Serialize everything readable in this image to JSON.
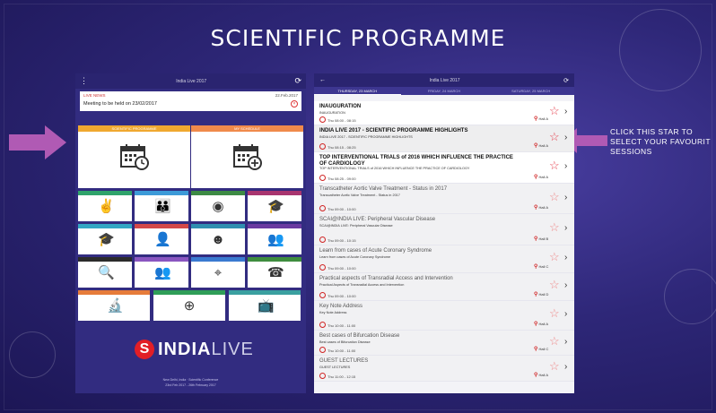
{
  "slide": {
    "title": "SCIENTIFIC PROGRAMME",
    "callout": "CLICK THIS STAR TO SELECT YOUR FAVOURIT SESSIONS"
  },
  "left_app": {
    "header_title": "India Live 2017",
    "menu_icon": "menu-icon",
    "refresh_icon": "refresh-icon",
    "notice": {
      "title": "LIVE NEWS",
      "date": "22.Feb.2017",
      "message": "Meeting to be held on 23/02/2017"
    },
    "big_tiles": [
      {
        "label": "SCIENTIFIC PROGRAMME",
        "color": "#f0a830",
        "icon": "calendar-clock-icon"
      },
      {
        "label": "MY SCHEDULE",
        "color": "#f08a4b",
        "icon": "calendar-add-icon"
      }
    ],
    "tiles": [
      {
        "color": "#2fa36b",
        "icon": "handshake-icon",
        "glyph": "✌"
      },
      {
        "color": "#3c9ad8",
        "icon": "group-icon",
        "glyph": "👪"
      },
      {
        "color": "#3d8a44",
        "icon": "book-icon",
        "glyph": "◉"
      },
      {
        "color": "#a8356f",
        "icon": "presenter-icon",
        "glyph": "🎓"
      },
      {
        "color": "#33a7c4",
        "icon": "board-presenter-icon",
        "glyph": "🎓"
      },
      {
        "color": "#d44848",
        "icon": "speaker-icon",
        "glyph": "👤"
      },
      {
        "color": "#2f8fb0",
        "icon": "chat-person-icon",
        "glyph": "☻"
      },
      {
        "color": "#6a3aa0",
        "icon": "meeting-icon",
        "glyph": "👥"
      },
      {
        "color": "#2b2b2b",
        "icon": "search-icon",
        "glyph": "🔍"
      },
      {
        "color": "#8a56c0",
        "icon": "users-icon",
        "glyph": "👥"
      },
      {
        "color": "#3a7ad0",
        "icon": "location-pin-icon",
        "glyph": "⌖"
      },
      {
        "color": "#3f8d3f",
        "icon": "phone-icon",
        "glyph": "☎"
      },
      {
        "color": "#e67c3a",
        "icon": "microscope-icon",
        "glyph": "🔬"
      },
      {
        "color": "#2f9e58",
        "icon": "hotel-icon",
        "glyph": "⊕"
      },
      {
        "color": "#3aa0a0",
        "icon": "tv-icon",
        "glyph": "📺"
      }
    ],
    "logo": {
      "letter": "S",
      "text_bold": "INDIA",
      "text_light": "LIVE"
    },
    "footer1": "New Delhi, India · Scientific Conference",
    "footer2": "23rd Feb 2017 - 26th February 2017"
  },
  "right_app": {
    "header_title": "India Live 2017",
    "back_icon": "back-arrow-icon",
    "tabs": [
      "THURSDAY, 23 MARCH",
      "FRIDAY, 24 MARCH",
      "SATURDAY, 25 MARCH"
    ],
    "sessions": [
      {
        "title": "INAUGURATION",
        "subtitle": "INAUGURATION",
        "time": "Thu 08:00 - 08:15",
        "hall": "Hall A",
        "style": "normal"
      },
      {
        "title": "INDIA LIVE 2017 - SCIENTIFIC PROGRAMME HIGHLIGHTS",
        "subtitle": "INDIA LIVE 2017 - SCIENTIFIC PROGRAMME HIGHLIGHTS",
        "time": "Thu 08:15 - 08:25",
        "hall": "Hall A",
        "style": "hi"
      },
      {
        "title": "TOP INTERVENTIONAL TRIALS of 2016 WHICH INFLUENCE THE PRACTICE OF CARDIOLOGY",
        "subtitle": "TOP INTERVENTIONAL TRIALS of 2016 WHICH INFLUENCE THE PRACTICE OF CARDIOLOGY",
        "time": "Thu 08:25 - 09:00",
        "hall": "Hall A",
        "style": "normal"
      },
      {
        "title": "Transcatheter Aortic Valve Treatment - Status in 2017",
        "subtitle": "Transcatheter Aortic Valve Treatment - Status in 2017",
        "time": "Thu 09:00 - 10:00",
        "hall": "Hall A",
        "style": "grey"
      },
      {
        "title": "SCAI@INDIA LIVE: Peripheral Vascular Disease",
        "subtitle": "SCAI@INDIA LIVE: Peripheral Vascular Disease",
        "time": "Thu 09:00 - 10:15",
        "hall": "Hall B",
        "style": "grey"
      },
      {
        "title": "Learn from cases of Acute Coronary Syndrome",
        "subtitle": "Learn from cases of Acute Coronary Syndrome",
        "time": "Thu 09:00 - 10:00",
        "hall": "Hall C",
        "style": "grey"
      },
      {
        "title": "Practical aspects of Transradial Access and Intervention",
        "subtitle": "Practical Aspects of Transradial Access and Intervention",
        "time": "Thu 09:00 - 10:00",
        "hall": "Hall D",
        "style": "grey"
      },
      {
        "title": "Key Note Address",
        "subtitle": "Key Note Address",
        "time": "Thu 10:00 - 11:00",
        "hall": "Hall A",
        "style": "grey"
      },
      {
        "title": "Best cases of Bifurcation Disease",
        "subtitle": "Best cases of Bifurcation Disease",
        "time": "Thu 10:00 - 11:00",
        "hall": "Hall C",
        "style": "grey"
      },
      {
        "title": "GUEST LECTURES",
        "subtitle": "GUEST LECTURES",
        "time": "Thu 11:00 - 12:15",
        "hall": "Hall A",
        "style": "grey"
      }
    ]
  }
}
